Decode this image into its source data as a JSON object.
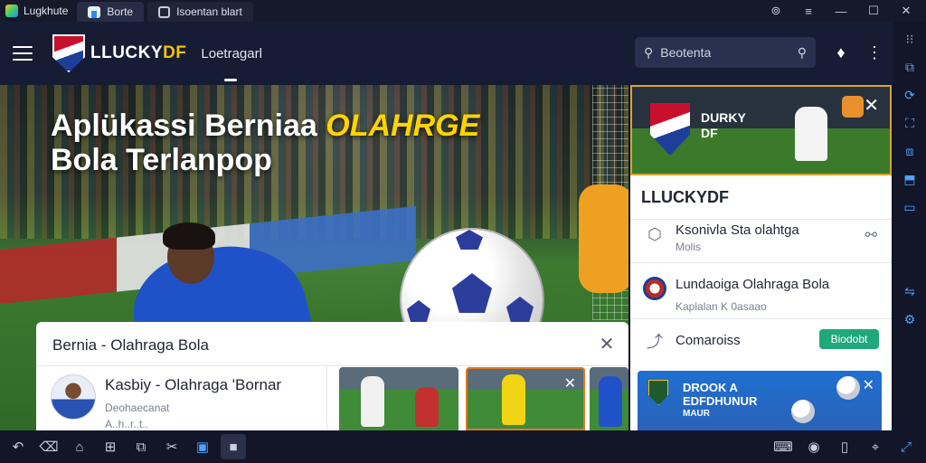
{
  "titlebar": {
    "app_name": "Lugkhute",
    "tabs": [
      {
        "label": "Borte",
        "icon": "home-icon"
      },
      {
        "label": "Isoentan blart",
        "icon": "app-icon"
      }
    ],
    "controls": [
      "help-icon",
      "menu-icon",
      "minimize-icon",
      "maximize-icon",
      "close-icon"
    ]
  },
  "header": {
    "brand_main": "LLUCKY",
    "brand_accent": "DF",
    "nav_link": "Loetragarl",
    "search_placeholder": "Beotenta"
  },
  "hero": {
    "title_prefix": "Aplükassi Berniaa ",
    "title_highlight": "OLAHRGE",
    "title_line2": "Bola Terlanpop"
  },
  "popup": {
    "title": "Bernia - Olahraga Bola",
    "item_title": "Kasbiy - Olahraga 'Bornar",
    "item_sub": "Deohaecanat",
    "item_sub2": "A..h..r..t.."
  },
  "side_panel": {
    "banner_name": "DURKY DF",
    "heading": "LLUCKYDF",
    "item1_title": "Ksonivla  Sta olahtga",
    "item1_sub": "Molis",
    "item2_title": "Lundaoiga Olahraga Bola",
    "item2_sub": "Kaplalan K 0asaao",
    "item3_title": "Comaroiss",
    "button_label": "Biodobt",
    "promo_line1": "DROOK A",
    "promo_line2": "EDFDHUNUR",
    "promo_line3": "MAUR"
  },
  "taskbar": {
    "left": [
      "back-icon",
      "eraser-icon",
      "home-icon",
      "apps-icon",
      "recent-icon",
      "scissors-icon",
      "screen-icon",
      "app-icon"
    ],
    "right": [
      "keyboard-icon",
      "camera-icon",
      "battery-icon",
      "location-icon",
      "expand-icon"
    ]
  },
  "colors": {
    "accent_yellow": "#ffd400",
    "header_bg": "#161c33",
    "primary_blue": "#4ea3ff",
    "button_green": "#1fa87b"
  }
}
